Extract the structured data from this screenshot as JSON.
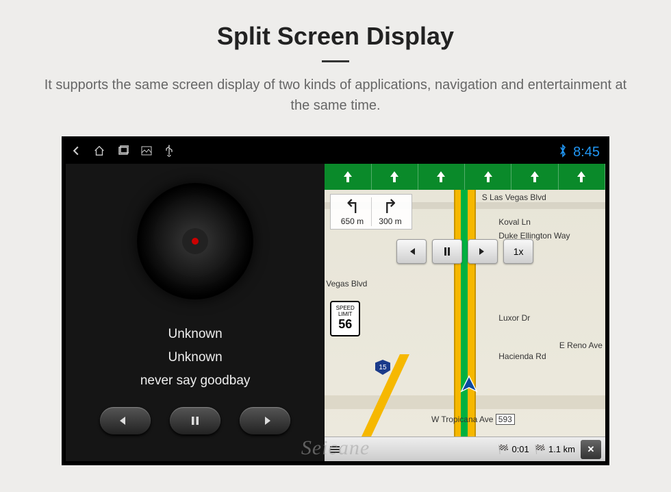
{
  "page": {
    "title": "Split Screen Display",
    "description": "It supports the same screen display of two kinds of applications, navigation and entertainment at the same time."
  },
  "status_bar": {
    "clock": "8:45"
  },
  "music": {
    "artist": "Unknown",
    "album": "Unknown",
    "track": "never say goodbay"
  },
  "nav": {
    "turn1_dist": "650 m",
    "turn2_dist": "300 m",
    "speed_button": "1x",
    "speed_limit_top": "SPEED",
    "speed_limit_mid": "LIMIT",
    "speed_limit_val": "56",
    "interstate": "15",
    "labels": {
      "s_las_vegas": "S Las Vegas Blvd",
      "koval": "Koval Ln",
      "duke": "Duke Ellington Way",
      "luxor": "Luxor Dr",
      "hacienda": "Hacienda Rd",
      "reno": "E Reno Ave",
      "vegas_blvd": "Vegas Blvd",
      "tropicana": "W Tropicana Ave",
      "tropicana_num": "593"
    },
    "bottom": {
      "time": "0:01",
      "dist": "1.1 km"
    }
  },
  "watermark": "Seicane"
}
